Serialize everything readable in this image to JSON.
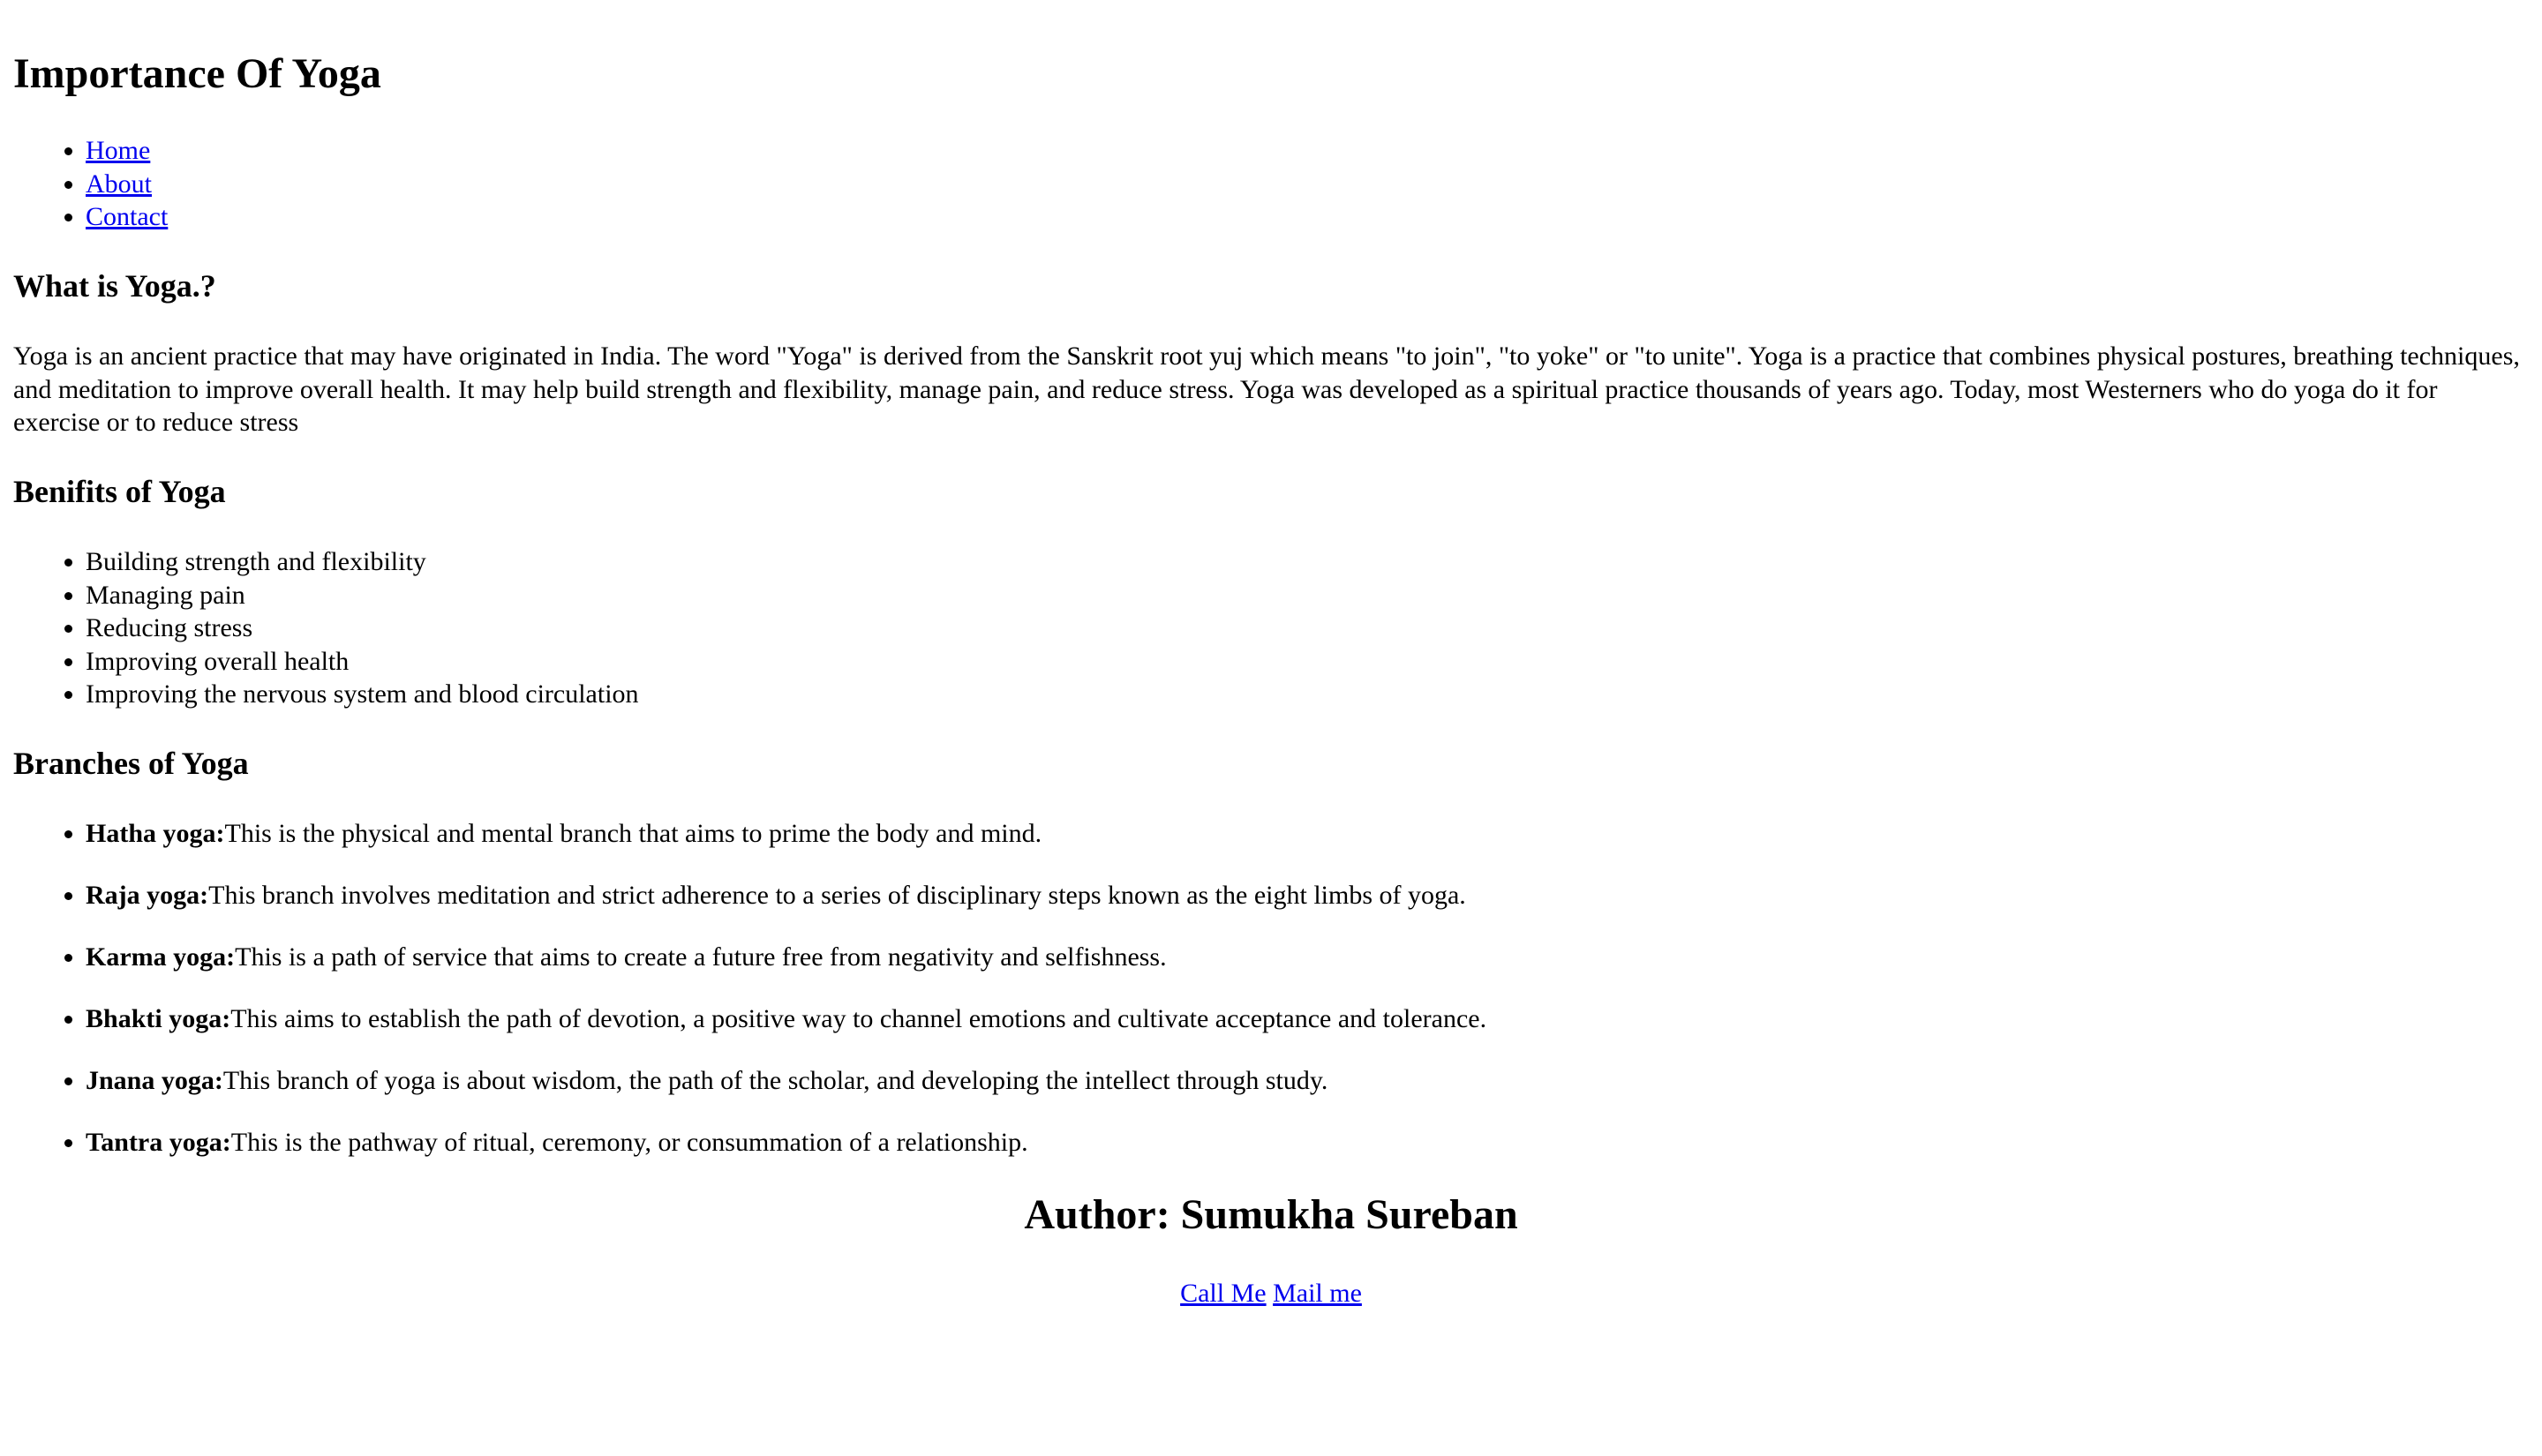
{
  "header": {
    "title": "Importance Of Yoga"
  },
  "nav": {
    "items": [
      {
        "label": "Home"
      },
      {
        "label": "About"
      },
      {
        "label": "Contact"
      }
    ]
  },
  "what_is": {
    "heading": "What is Yoga.?",
    "text": "Yoga is an ancient practice that may have originated in India. The word \"Yoga\" is derived from the Sanskrit root yuj which means \"to join\", \"to yoke\" or \"to unite\". Yoga is a practice that combines physical postures, breathing techniques, and meditation to improve overall health. It may help build strength and flexibility, manage pain, and reduce stress. Yoga was developed as a spiritual practice thousands of years ago. Today, most Westerners who do yoga do it for exercise or to reduce stress"
  },
  "benefits": {
    "heading": "Benifits of Yoga",
    "items": [
      "Building strength and flexibility",
      "Managing pain",
      "Reducing stress",
      "Improving overall health",
      "Improving the nervous system and blood circulation"
    ]
  },
  "branches": {
    "heading": "Branches of Yoga",
    "items": [
      {
        "name": "Hatha yoga:",
        "text": "This is the physical and mental branch that aims to prime the body and mind."
      },
      {
        "name": "Raja yoga:",
        "text": "This branch involves meditation and strict adherence to a series of disciplinary steps known as the eight limbs of yoga."
      },
      {
        "name": "Karma yoga:",
        "text": "This is a path of service that aims to create a future free from negativity and selfishness."
      },
      {
        "name": "Bhakti yoga:",
        "text": "This aims to establish the path of devotion, a positive way to channel emotions and cultivate acceptance and tolerance."
      },
      {
        "name": "Jnana yoga:",
        "text": "This branch of yoga is about wisdom, the path of the scholar, and developing the intellect through study."
      },
      {
        "name": "Tantra yoga:",
        "text": "This is the pathway of ritual, ceremony, or consummation of a relationship."
      }
    ]
  },
  "footer": {
    "author": "Author: Sumukha Sureban",
    "call_label": "Call Me",
    "mail_label": "Mail me"
  },
  "colors": {
    "link": "#0000ee",
    "text": "#000000",
    "background": "#ffffff"
  }
}
